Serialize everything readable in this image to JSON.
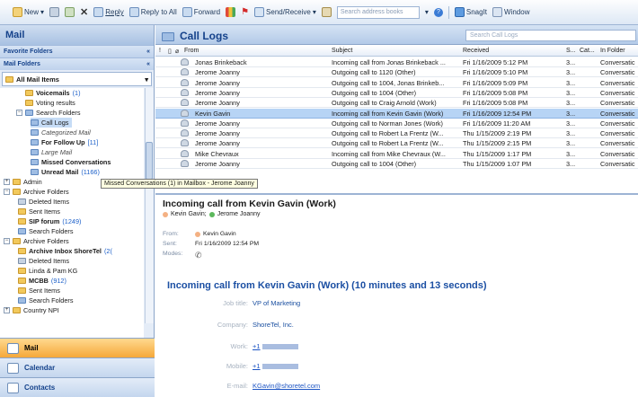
{
  "toolbar": {
    "new": "New",
    "reply": "Reply",
    "reply_all": "Reply to All",
    "forward": "Forward",
    "send_receive": "Send/Receive",
    "search_placeholder": "Search address books",
    "snagit": "SnagIt",
    "window": "Window"
  },
  "nav": {
    "title": "Mail",
    "favorites": "Favorite Folders",
    "mail_folders": "Mail Folders",
    "all_items": "All Mail Items",
    "tree": [
      {
        "label": "Voicemails",
        "count": "(1)"
      },
      {
        "label": "Voting results",
        "count": ""
      },
      {
        "label": "Search Folders",
        "count": ""
      },
      {
        "label": "Call Logs",
        "count": ""
      },
      {
        "label": "Categorized Mail",
        "count": ""
      },
      {
        "label": "For Follow Up",
        "count": "[11]"
      },
      {
        "label": "Large Mail",
        "count": ""
      },
      {
        "label": "Missed Conversations",
        "count": ""
      },
      {
        "label": "Unread Mail",
        "count": "(1166)"
      },
      {
        "label": "Admin",
        "count": ""
      },
      {
        "label": "Archive Folders",
        "count": ""
      },
      {
        "label": "Deleted Items",
        "count": ""
      },
      {
        "label": "Sent Items",
        "count": ""
      },
      {
        "label": "SIP forum",
        "count": "(1249)"
      },
      {
        "label": "Search Folders",
        "count": ""
      },
      {
        "label": "Archive Folders",
        "count": ""
      },
      {
        "label": "Archive Inbox ShoreTel",
        "count": "(2("
      },
      {
        "label": "Deleted Items",
        "count": ""
      },
      {
        "label": "Linda & Pam KG",
        "count": ""
      },
      {
        "label": "MCBB",
        "count": "(912)"
      },
      {
        "label": "Sent Items",
        "count": ""
      },
      {
        "label": "Search Folders",
        "count": ""
      },
      {
        "label": "Country NPI",
        "count": ""
      }
    ],
    "buttons": [
      "Mail",
      "Calendar",
      "Contacts"
    ]
  },
  "tooltip": "Missed Conversations (1) in Mailbox - Jerome Joanny",
  "content": {
    "title": "Call Logs",
    "search_placeholder": "Search Call Logs",
    "columns": {
      "from": "From",
      "subject": "Subject",
      "received": "Received",
      "size": "S...",
      "cat": "Cat...",
      "folder": "In Folder"
    },
    "rows": [
      {
        "from": "Jonas Brinkeback",
        "subject": "Incoming call from Jonas Brinkeback ...",
        "received": "Fri 1/16/2009 5:12 PM",
        "size": "3...",
        "folder": "Conversatic"
      },
      {
        "from": "Jerome Joanny",
        "subject": "Outgoing call to 1120 (Other)",
        "received": "Fri 1/16/2009 5:10 PM",
        "size": "3...",
        "folder": "Conversatic"
      },
      {
        "from": "Jerome Joanny",
        "subject": "Outgoing call to 1004, Jonas Brinkeb...",
        "received": "Fri 1/16/2009 5:09 PM",
        "size": "3...",
        "folder": "Conversatic"
      },
      {
        "from": "Jerome Joanny",
        "subject": "Outgoing call to 1004 (Other)",
        "received": "Fri 1/16/2009 5:08 PM",
        "size": "3...",
        "folder": "Conversatic"
      },
      {
        "from": "Jerome Joanny",
        "subject": "Outgoing call to Craig Arnold (Work)",
        "received": "Fri 1/16/2009 5:08 PM",
        "size": "3...",
        "folder": "Conversatic"
      },
      {
        "from": "Kevin Gavin",
        "subject": "Incoming call from Kevin Gavin (Work)",
        "received": "Fri 1/16/2009 12:54 PM",
        "size": "3...",
        "folder": "Conversatic"
      },
      {
        "from": "Jerome Joanny",
        "subject": "Outgoing call to Norman Jones (Work)",
        "received": "Fri 1/16/2009 11:20 AM",
        "size": "3...",
        "folder": "Conversatic"
      },
      {
        "from": "Jerome Joanny",
        "subject": "Outgoing call to Robert La Frentz (W...",
        "received": "Thu 1/15/2009 2:19 PM",
        "size": "3...",
        "folder": "Conversatic"
      },
      {
        "from": "Jerome Joanny",
        "subject": "Outgoing call to Robert La Frentz (W...",
        "received": "Thu 1/15/2009 2:15 PM",
        "size": "3...",
        "folder": "Conversatic"
      },
      {
        "from": "Mike Chevraux",
        "subject": "Incoming call from Mike Chevraux (W...",
        "received": "Thu 1/15/2009 1:17 PM",
        "size": "3...",
        "folder": "Conversatic"
      },
      {
        "from": "Jerome Joanny",
        "subject": "Outgoing call to 1004 (Other)",
        "received": "Thu 1/15/2009 1:07 PM",
        "size": "3...",
        "folder": "Conversatic"
      }
    ]
  },
  "reading": {
    "subject": "Incoming call from Kevin Gavin (Work)",
    "person1": "Kevin Gavin;",
    "person2": "Jerome Joanny",
    "from_label": "From:",
    "from_value": "Kevin Gavin",
    "sent_label": "Sent:",
    "sent_value": "Fri 1/16/2009 12:54 PM",
    "modes_label": "Modes:",
    "heading": "Incoming call from Kevin Gavin (Work) (10 minutes and 13 seconds)",
    "job_label": "Job title:",
    "job_value": "VP of Marketing",
    "company_label": "Company:",
    "company_value": "ShoreTel, Inc.",
    "work_label": "Work:",
    "work_value": "+1",
    "mobile_label": "Mobile:",
    "mobile_value": "+1",
    "email_label": "E-mail:",
    "email_value": "KGavin@shoretel.com"
  },
  "colors": {
    "accent": "#15428b",
    "selection": "#b7d4f5",
    "active_nav": "#f5a83a"
  }
}
